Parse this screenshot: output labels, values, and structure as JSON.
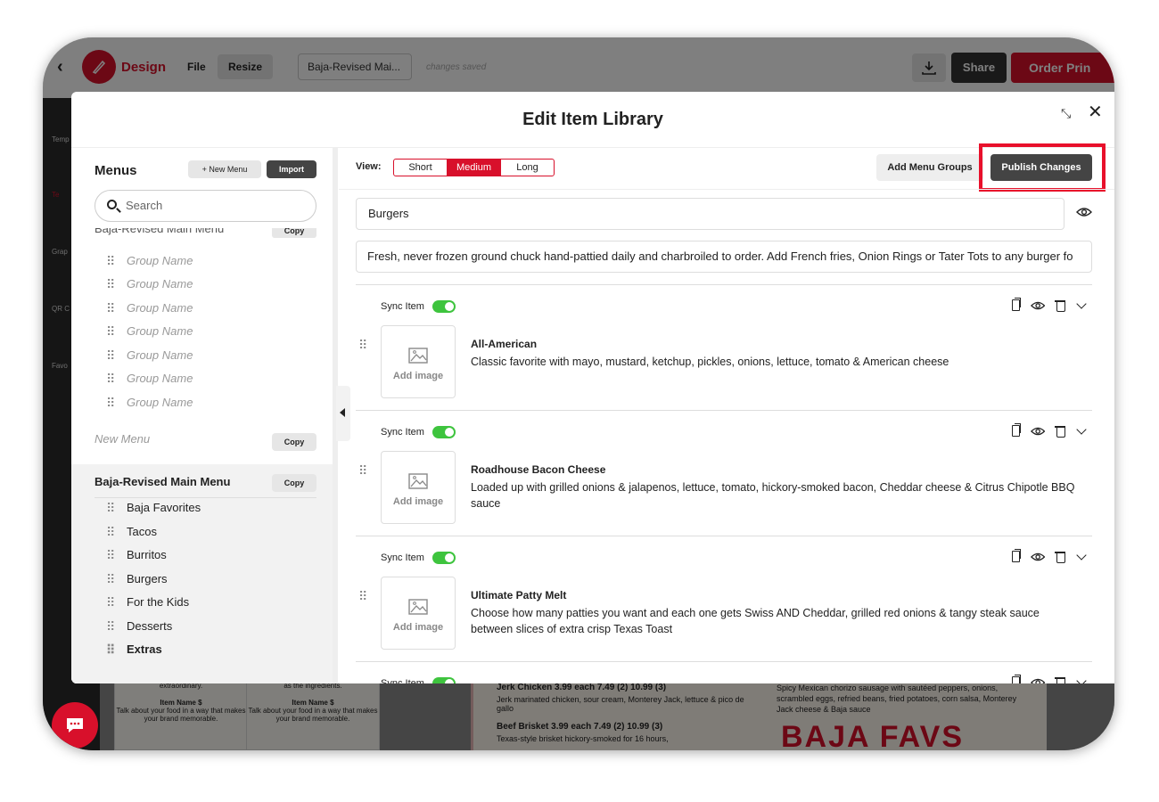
{
  "app": {
    "brand": "Design",
    "file_menu": "File",
    "resize_button": "Resize",
    "document_name": "Baja-Revised Mai...",
    "save_status": "changes saved",
    "share_button": "Share",
    "order_button": "Order Prin",
    "brand_color": "#d8102b"
  },
  "sidebar": {
    "items": [
      "Temp",
      "Te",
      "Grap",
      "QR C",
      "Favo"
    ]
  },
  "background_menu": {
    "card1_text": "extraordinary.",
    "card1_item": "Item Name $",
    "card1_desc": "Talk about your food in a way that makes your brand memorable.",
    "card2_text": "as the ingredients.",
    "card2_item": "Item Name $",
    "card2_desc": "Talk about your food in a way that makes your brand memorable.",
    "line1": "Jerk Chicken 3.99 each 7.49 (2) 10.99 (3)",
    "line2": "Jerk marinated chicken, sour cream, Monterey Jack, lettuce & pico de gallo",
    "line3": "Beef Brisket 3.99 each 7.49 (2) 10.99 (3)",
    "line4": "Texas-style brisket hickory-smoked for 16 hours,",
    "right1": "Spicy Mexican chorizo sausage with sautéed peppers, onions, scrambled eggs, refried beans, fried potatoes, corn salsa, Monterey Jack cheese & Baja sauce",
    "banner": "BAJA FAVS"
  },
  "modal": {
    "title": "Edit Item Library",
    "left": {
      "heading": "Menus",
      "new_menu_button": "+ New Menu",
      "import_button": "Import",
      "search_placeholder": "Search",
      "cut_menu_name": "Baja-Revised Main Menu",
      "copy_label": "Copy",
      "placeholder_groups": [
        "Group Name",
        "Group Name",
        "Group Name",
        "Group Name",
        "Group Name",
        "Group Name",
        "Group Name"
      ],
      "new_menu_label": "New Menu",
      "active_menu_name": "Baja-Revised Main Menu",
      "active_groups": [
        "Baja Favorites",
        "Tacos",
        "Burritos",
        "Burgers",
        "For the Kids",
        "Desserts",
        "Extras"
      ]
    },
    "right": {
      "view_label": "View:",
      "view_options": [
        "Short",
        "Medium",
        "Long"
      ],
      "view_selected": "Medium",
      "add_groups_button": "Add Menu Groups",
      "publish_button": "Publish Changes",
      "group_name": "Burgers",
      "group_description": "Fresh, never frozen ground chuck hand-pattied daily and charbroiled to order.  Add French fries, Onion Rings or Tater Tots to any burger fo",
      "sync_label": "Sync Item",
      "add_image_label": "Add image",
      "items": [
        {
          "name": "All-American",
          "description": "Classic favorite with mayo, mustard, ketchup, pickles, onions, lettuce, tomato & American cheese"
        },
        {
          "name": "Roadhouse Bacon Cheese",
          "description": "Loaded up with grilled onions & jalapenos, lettuce, tomato, hickory-smoked bacon, Cheddar cheese & Citrus Chipotle BBQ sauce"
        },
        {
          "name": "Ultimate Patty Melt",
          "description": "Choose how many patties you want and each one gets Swiss AND Cheddar, grilled red onions & tangy steak sauce between slices of extra crisp Texas Toast"
        }
      ]
    }
  }
}
